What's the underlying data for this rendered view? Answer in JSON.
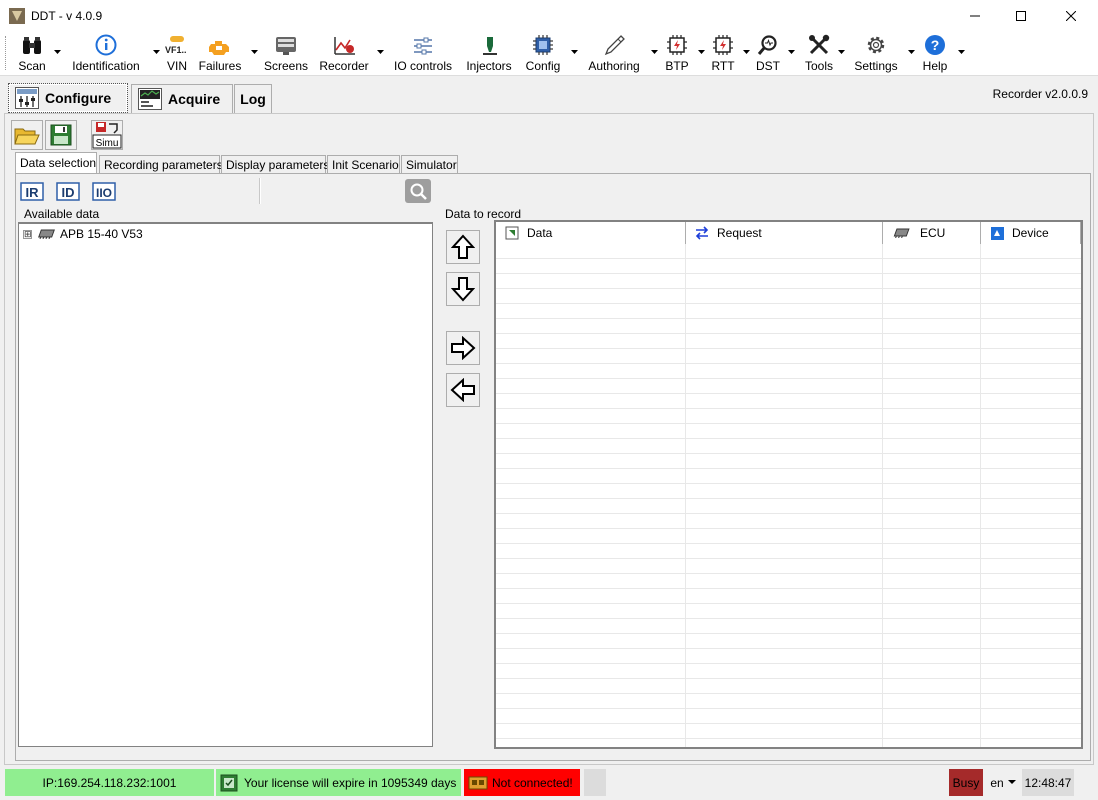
{
  "window": {
    "title": "DDT - v 4.0.9",
    "icon": "ddt-app-icon"
  },
  "toolbar": {
    "items": [
      {
        "label": "Scan",
        "icon": "binoculars-icon"
      },
      {
        "label": "Identification",
        "icon": "info-icon"
      },
      {
        "label": "VIN",
        "icon": "vin-icon",
        "icon_text": "VF1.."
      },
      {
        "label": "Failures",
        "icon": "engine-warning-icon"
      },
      {
        "label": "Screens",
        "icon": "screens-icon"
      },
      {
        "label": "Recorder",
        "icon": "recorder-chart-icon"
      },
      {
        "label": "IO controls",
        "icon": "sliders-icon"
      },
      {
        "label": "Injectors",
        "icon": "injector-icon"
      },
      {
        "label": "Config",
        "icon": "chip-icon"
      },
      {
        "label": "Authoring",
        "icon": "pen-icon"
      },
      {
        "label": "BTP",
        "icon": "btp-icon"
      },
      {
        "label": "RTT",
        "icon": "rtt-icon"
      },
      {
        "label": "DST",
        "icon": "magnifier-icon"
      },
      {
        "label": "Tools",
        "icon": "tools-icon"
      },
      {
        "label": "Settings",
        "icon": "gear-icon"
      },
      {
        "label": "Help",
        "icon": "help-icon"
      }
    ]
  },
  "main_tabs": [
    {
      "label": "Configure",
      "active": true
    },
    {
      "label": "Acquire",
      "active": false
    },
    {
      "label": "Log",
      "active": false
    }
  ],
  "version": "Recorder v2.0.0.9",
  "sub_tabs": [
    {
      "label": "Data selection",
      "active": true
    },
    {
      "label": "Recording parameters",
      "active": false
    },
    {
      "label": "Display parameters",
      "active": false
    },
    {
      "label": "Init Scenario",
      "active": false
    },
    {
      "label": "Simulator",
      "active": false
    }
  ],
  "simu_label": "Simu",
  "mini_buttons": [
    "IR",
    "ID",
    "IIO"
  ],
  "available": {
    "label": "Available data",
    "tree": [
      {
        "label": "APB 15-40 V53",
        "expander": "⊞"
      }
    ]
  },
  "record": {
    "label": "Data to record",
    "columns": [
      {
        "label": "Data",
        "icon": "data-icon"
      },
      {
        "label": "Request",
        "icon": "swap-arrows-icon"
      },
      {
        "label": "ECU",
        "icon": "ecu-chip-icon"
      },
      {
        "label": "Device",
        "icon": "device-icon"
      }
    ],
    "rows": []
  },
  "status": {
    "ip": "IP:169.254.118.232:1001",
    "license": "Your license will expire in 1095349 days",
    "connection": "Not connected!",
    "busy": "Busy",
    "language": "en",
    "time": "12:48:47"
  },
  "colors": {
    "status_ok": "#90ee90",
    "status_error": "#ff0000",
    "busy": "#a52a2a"
  }
}
